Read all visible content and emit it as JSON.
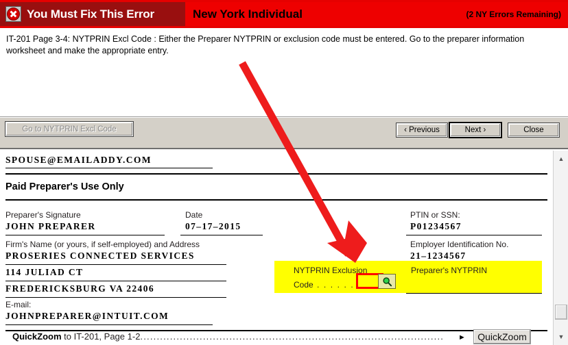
{
  "banner": {
    "error_icon": "error-x-icon",
    "title": "You Must Fix This Error",
    "form_name": "New York Individual",
    "errors_remaining": "(2 NY Errors Remaining)",
    "bg_color": "#ee0000",
    "left_bg_color": "#990f0f"
  },
  "message": {
    "text": "IT-201 Page 3-4: NYTPRIN Excl Code : Either the Preparer NYTPRIN or exclusion code must be entered.  Go to the preparer information worksheet and make the appropriate entry."
  },
  "toolbar": {
    "goto_label": "Go to NYTPRIN Excl Code",
    "goto_disabled": true,
    "previous_label": "‹ Previous",
    "next_label": "Next ›",
    "close_label": "Close"
  },
  "form": {
    "spouse_email": "SPOUSE@EMAILADDY.COM",
    "section_heading": "Paid Preparer's Use Only",
    "preparer_signature_label": "Preparer's Signature",
    "preparer_signature_value": "JOHN  PREPARER",
    "date_label": "Date",
    "date_value": "07–17–2015",
    "firm_name_label": "Firm's Name (or yours, if self-employed) and Address",
    "firm_name_value": "PROSERIES  CONNECTED  SERVICES",
    "firm_address1": "114  JULIAD  CT",
    "firm_address2": "FREDERICKSBURG  VA  22406",
    "email_label": "E-mail:",
    "email_value": "JOHNPREPARER@INTUIT.COM",
    "ptin_label": "PTIN or SSN:",
    "ptin_value": "P01234567",
    "ein_label": "Employer Identification No.",
    "ein_value": "21–1234567",
    "preparer_nytprin_label": "Preparer's NYTPRIN",
    "preparer_nytprin_value": "",
    "excl_label_line1": "NYTPRIN Exclusion",
    "excl_label_line2": "Code",
    "excl_dots": ". . . . . . . . .",
    "excl_code_value": "",
    "magnifier_icon": "magnifier-icon",
    "highlight_color": "#ffff00",
    "focus_border_color": "#ff0000"
  },
  "footer": {
    "quickzoom_bold": "QuickZoom",
    "quickzoom_text": " to IT-201, Page 1-2",
    "quickzoom_dots": "............................................................................................",
    "arrow_glyph": "►",
    "quickzoom_button": "QuickZoom"
  },
  "scrollbar": {
    "up_glyph": "▲",
    "down_glyph": "▼"
  },
  "annotation": {
    "arrow_color": "#ee1c1c",
    "description": "red-arrow-pointing-to-nytprin-exclusion-code-field"
  }
}
